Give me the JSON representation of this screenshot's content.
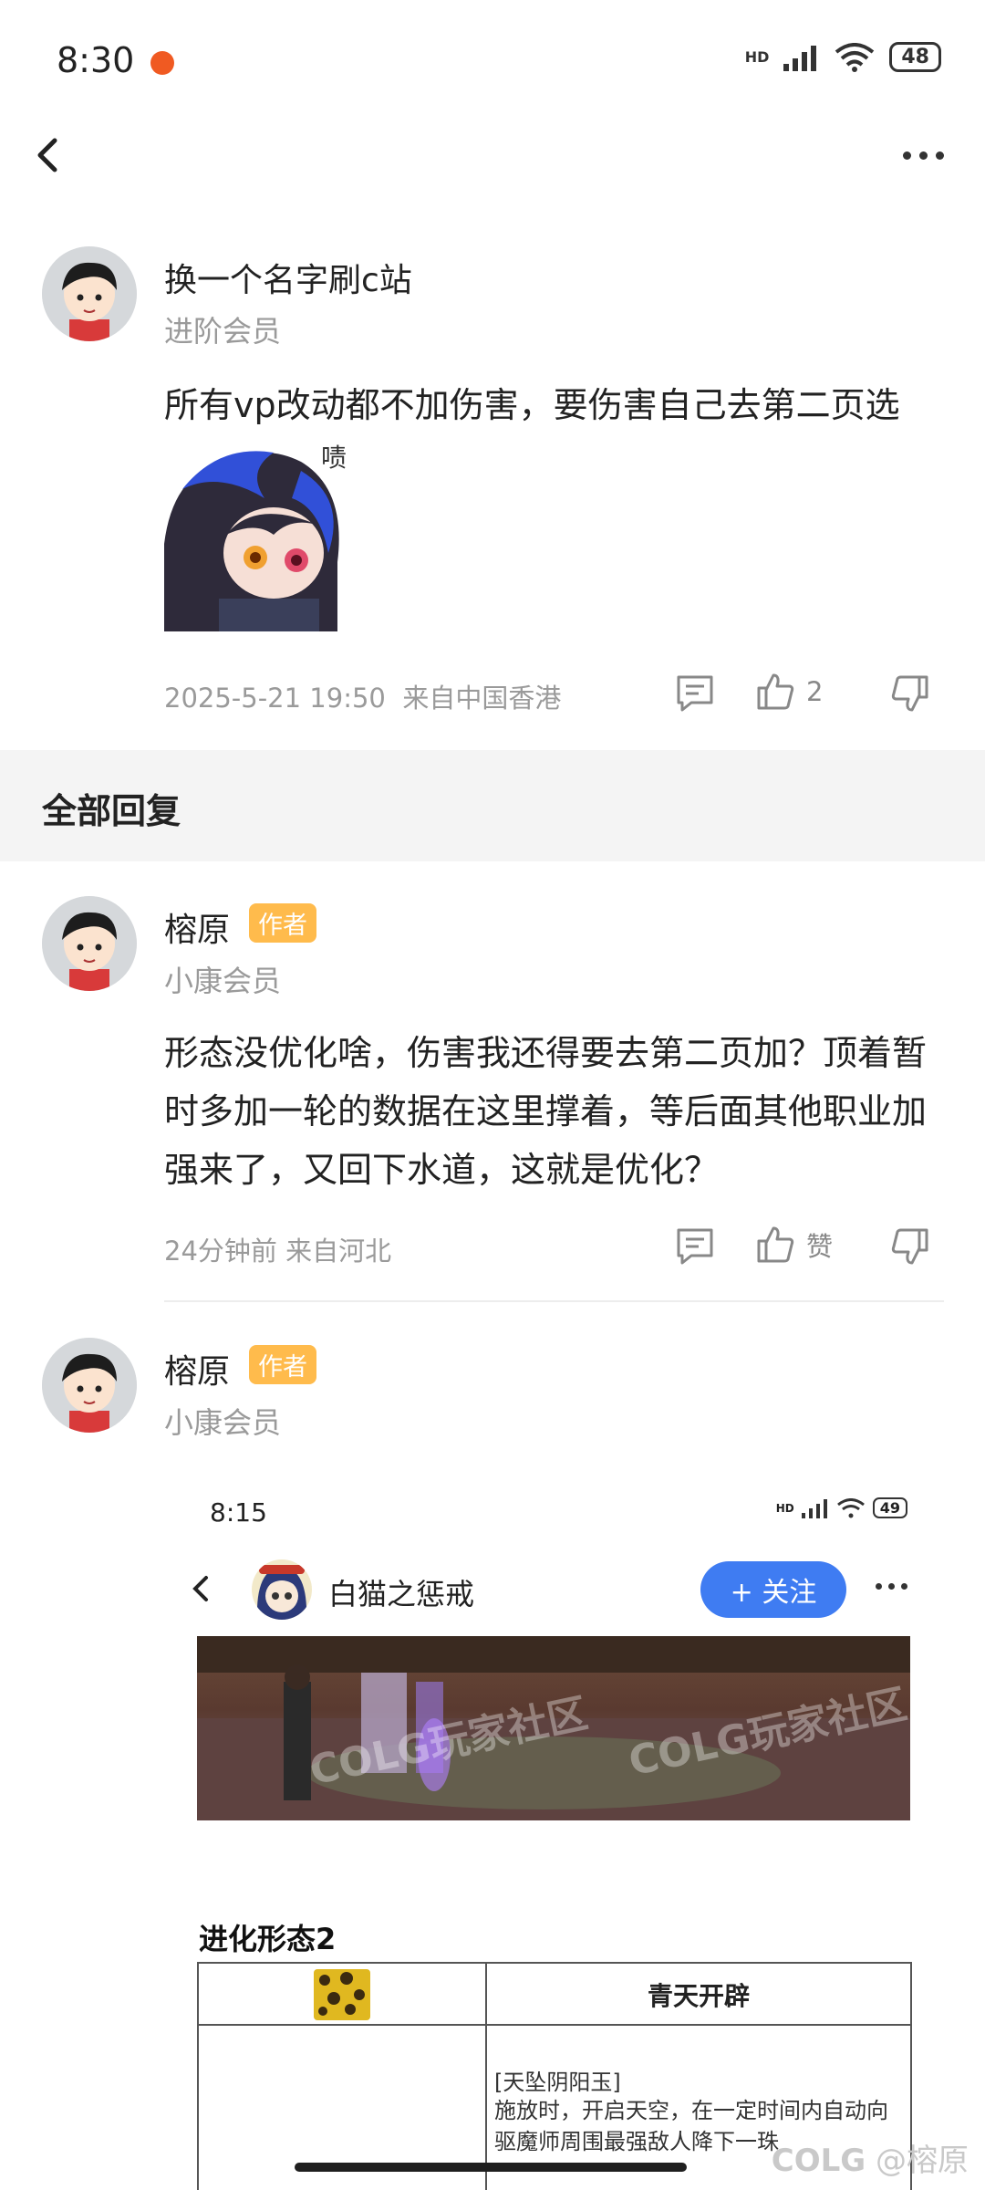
{
  "status_bar": {
    "time": "8:30",
    "network": "HD",
    "wifi_sub": "6",
    "battery": "48"
  },
  "post": {
    "username": "换一个名字刷c站",
    "level": "进阶会员",
    "text": "所有vp改动都不加伤害，要伤害自己去第二页选",
    "sticker_text": "啧",
    "timestamp": "2025-5-21 19:50",
    "location": "来自中国香港",
    "like_count": "2"
  },
  "section_title": "全部回复",
  "replies": [
    {
      "username": "榕原",
      "badge": "作者",
      "level": "小康会员",
      "text": "形态没优化啥，伤害我还得要去第二页加？顶着暂时多加一轮的数据在这里撑着，等后面其他职业加强来了，又回下水道，这就是优化？",
      "time": "24分钟前",
      "location": "来自河北",
      "like_label": "赞"
    },
    {
      "username": "榕原",
      "badge": "作者",
      "level": "小康会员"
    }
  ],
  "embedded": {
    "status_time": "8:15",
    "network": "HD",
    "battery": "49",
    "title": "白猫之惩戒",
    "follow_label": "+ 关注",
    "banner_watermark": "COLG玩家社区",
    "section_heading": "进化形态2",
    "table_header": "青天开辟",
    "skill_name": "[天坠阴阳玉]",
    "skill_desc": "施放时，开启天空，在一定时间内自动向驱魔师周围最强敌人降下一珠"
  },
  "watermark": "@榕原",
  "watermark_brand": "COLG"
}
